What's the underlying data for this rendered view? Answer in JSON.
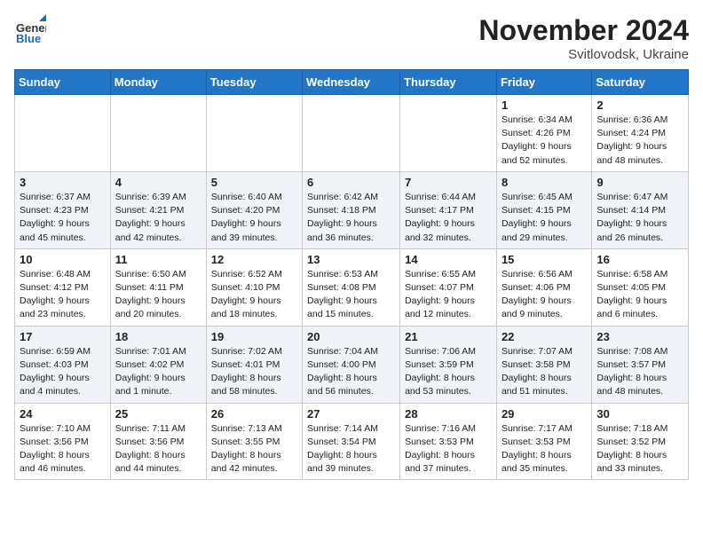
{
  "header": {
    "logo_general": "General",
    "logo_blue": "Blue",
    "month_year": "November 2024",
    "location": "Svitlovodsk, Ukraine"
  },
  "weekdays": [
    "Sunday",
    "Monday",
    "Tuesday",
    "Wednesday",
    "Thursday",
    "Friday",
    "Saturday"
  ],
  "weeks": [
    [
      {
        "day": "",
        "info": ""
      },
      {
        "day": "",
        "info": ""
      },
      {
        "day": "",
        "info": ""
      },
      {
        "day": "",
        "info": ""
      },
      {
        "day": "",
        "info": ""
      },
      {
        "day": "1",
        "info": "Sunrise: 6:34 AM\nSunset: 4:26 PM\nDaylight: 9 hours\nand 52 minutes."
      },
      {
        "day": "2",
        "info": "Sunrise: 6:36 AM\nSunset: 4:24 PM\nDaylight: 9 hours\nand 48 minutes."
      }
    ],
    [
      {
        "day": "3",
        "info": "Sunrise: 6:37 AM\nSunset: 4:23 PM\nDaylight: 9 hours\nand 45 minutes."
      },
      {
        "day": "4",
        "info": "Sunrise: 6:39 AM\nSunset: 4:21 PM\nDaylight: 9 hours\nand 42 minutes."
      },
      {
        "day": "5",
        "info": "Sunrise: 6:40 AM\nSunset: 4:20 PM\nDaylight: 9 hours\nand 39 minutes."
      },
      {
        "day": "6",
        "info": "Sunrise: 6:42 AM\nSunset: 4:18 PM\nDaylight: 9 hours\nand 36 minutes."
      },
      {
        "day": "7",
        "info": "Sunrise: 6:44 AM\nSunset: 4:17 PM\nDaylight: 9 hours\nand 32 minutes."
      },
      {
        "day": "8",
        "info": "Sunrise: 6:45 AM\nSunset: 4:15 PM\nDaylight: 9 hours\nand 29 minutes."
      },
      {
        "day": "9",
        "info": "Sunrise: 6:47 AM\nSunset: 4:14 PM\nDaylight: 9 hours\nand 26 minutes."
      }
    ],
    [
      {
        "day": "10",
        "info": "Sunrise: 6:48 AM\nSunset: 4:12 PM\nDaylight: 9 hours\nand 23 minutes."
      },
      {
        "day": "11",
        "info": "Sunrise: 6:50 AM\nSunset: 4:11 PM\nDaylight: 9 hours\nand 20 minutes."
      },
      {
        "day": "12",
        "info": "Sunrise: 6:52 AM\nSunset: 4:10 PM\nDaylight: 9 hours\nand 18 minutes."
      },
      {
        "day": "13",
        "info": "Sunrise: 6:53 AM\nSunset: 4:08 PM\nDaylight: 9 hours\nand 15 minutes."
      },
      {
        "day": "14",
        "info": "Sunrise: 6:55 AM\nSunset: 4:07 PM\nDaylight: 9 hours\nand 12 minutes."
      },
      {
        "day": "15",
        "info": "Sunrise: 6:56 AM\nSunset: 4:06 PM\nDaylight: 9 hours\nand 9 minutes."
      },
      {
        "day": "16",
        "info": "Sunrise: 6:58 AM\nSunset: 4:05 PM\nDaylight: 9 hours\nand 6 minutes."
      }
    ],
    [
      {
        "day": "17",
        "info": "Sunrise: 6:59 AM\nSunset: 4:03 PM\nDaylight: 9 hours\nand 4 minutes."
      },
      {
        "day": "18",
        "info": "Sunrise: 7:01 AM\nSunset: 4:02 PM\nDaylight: 9 hours\nand 1 minute."
      },
      {
        "day": "19",
        "info": "Sunrise: 7:02 AM\nSunset: 4:01 PM\nDaylight: 8 hours\nand 58 minutes."
      },
      {
        "day": "20",
        "info": "Sunrise: 7:04 AM\nSunset: 4:00 PM\nDaylight: 8 hours\nand 56 minutes."
      },
      {
        "day": "21",
        "info": "Sunrise: 7:06 AM\nSunset: 3:59 PM\nDaylight: 8 hours\nand 53 minutes."
      },
      {
        "day": "22",
        "info": "Sunrise: 7:07 AM\nSunset: 3:58 PM\nDaylight: 8 hours\nand 51 minutes."
      },
      {
        "day": "23",
        "info": "Sunrise: 7:08 AM\nSunset: 3:57 PM\nDaylight: 8 hours\nand 48 minutes."
      }
    ],
    [
      {
        "day": "24",
        "info": "Sunrise: 7:10 AM\nSunset: 3:56 PM\nDaylight: 8 hours\nand 46 minutes."
      },
      {
        "day": "25",
        "info": "Sunrise: 7:11 AM\nSunset: 3:56 PM\nDaylight: 8 hours\nand 44 minutes."
      },
      {
        "day": "26",
        "info": "Sunrise: 7:13 AM\nSunset: 3:55 PM\nDaylight: 8 hours\nand 42 minutes."
      },
      {
        "day": "27",
        "info": "Sunrise: 7:14 AM\nSunset: 3:54 PM\nDaylight: 8 hours\nand 39 minutes."
      },
      {
        "day": "28",
        "info": "Sunrise: 7:16 AM\nSunset: 3:53 PM\nDaylight: 8 hours\nand 37 minutes."
      },
      {
        "day": "29",
        "info": "Sunrise: 7:17 AM\nSunset: 3:53 PM\nDaylight: 8 hours\nand 35 minutes."
      },
      {
        "day": "30",
        "info": "Sunrise: 7:18 AM\nSunset: 3:52 PM\nDaylight: 8 hours\nand 33 minutes."
      }
    ]
  ]
}
